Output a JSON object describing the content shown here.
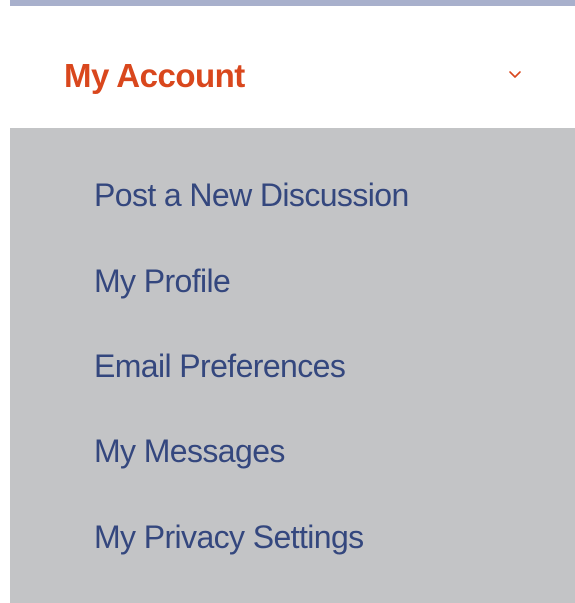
{
  "menu": {
    "title": "My Account",
    "title_color": "#d9471d",
    "toggle_icon": "chevron-down-icon",
    "expanded": true,
    "items": [
      {
        "label": "Post a New Discussion"
      },
      {
        "label": "My Profile"
      },
      {
        "label": "Email Preferences"
      },
      {
        "label": "My Messages"
      },
      {
        "label": "My Privacy Settings"
      }
    ],
    "item_color": "#34477e",
    "submenu_background": "#c3c4c6",
    "accent_rule_color": "#a8b0cc"
  }
}
